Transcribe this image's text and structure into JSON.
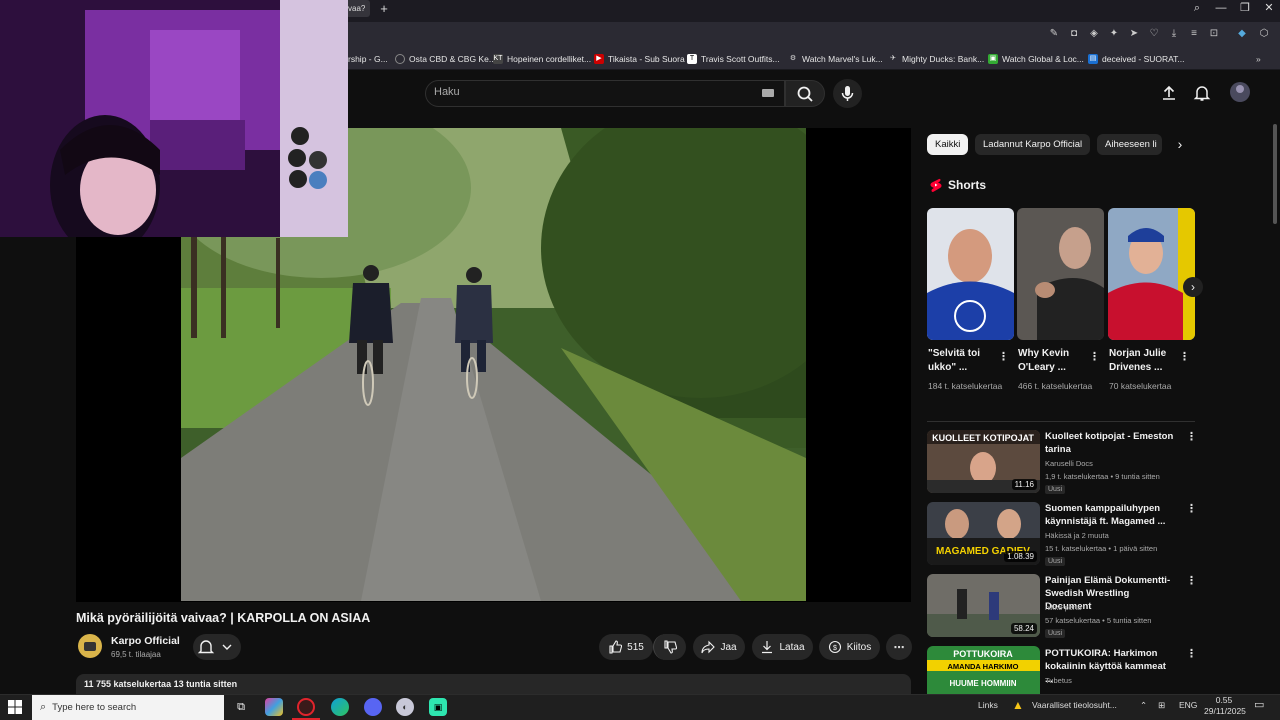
{
  "browser": {
    "active_tab_title": "vaa?",
    "bookmarks": [
      {
        "label": "rship - G...",
        "icon": "globe-icon"
      },
      {
        "label": "Osta CBD & CBG Ke...",
        "icon": "globe-icon"
      },
      {
        "label": "Hopeinen cordelliket...",
        "icon": "kt-icon"
      },
      {
        "label": "Tikaista - Sub Suora",
        "icon": "play-icon"
      },
      {
        "label": "Travis Scott Outfits...",
        "icon": "t-icon"
      },
      {
        "label": "Watch Marvel's Luk...",
        "icon": "gear-icon"
      },
      {
        "label": "Mighty Ducks: Bank...",
        "icon": "duck-icon"
      },
      {
        "label": "Watch Global & Loc...",
        "icon": "tv-icon"
      },
      {
        "label": "deceived - SUORAT...",
        "icon": "folder-icon"
      }
    ]
  },
  "header": {
    "search_placeholder": "Haku"
  },
  "video": {
    "title": "Mikä pyöräilijöitä vaivaa? | KARPOLLA ON ASIAA",
    "channel_name": "Karpo Official",
    "subscribers": "69,5 t. tilaajaa",
    "likes": "515",
    "share_label": "Jaa",
    "download_label": "Lataa",
    "thanks_label": "Kiitos",
    "description_meta": "11 755 katselukertaa  13 tuntia sitten"
  },
  "chips": [
    "Kaikki",
    "Ladannut Karpo Official",
    "Aiheeseen li"
  ],
  "shorts": {
    "heading": "Shorts",
    "items": [
      {
        "title": "\"Selvitä toi ukko\" ...",
        "views": "184 t. katselukertaa"
      },
      {
        "title": "Why Kevin O'Leary ...",
        "views": "466 t. katselukertaa"
      },
      {
        "title": "Norjan Julie Drivenes ...",
        "views": "70 katselukertaa"
      }
    ]
  },
  "recommendations": [
    {
      "title": "Kuolleet kotipojat - Emeston tarina",
      "channel": "Karuselli Docs",
      "meta": "1,9 t. katselukertaa • 9 tuntia sitten",
      "badge": "Uusi",
      "duration": "11.16"
    },
    {
      "title": "Suomen kamppailuhypen käynnistäjä ft. Magamed ...",
      "channel": "Häkissä ja 2 muuta",
      "meta": "15 t. katselukertaa • 1 päivä sitten",
      "badge": "Uusi",
      "duration": "1.08.39"
    },
    {
      "title": "Painijan Elämä Dokumentti- Swedish Wrestling Document",
      "channel": "nikke pena",
      "meta": "57 katselukertaa • 5 tuntia sitten",
      "badge": "Uusi",
      "duration": "58.24"
    },
    {
      "title": "POTTUKOIRA: Harkimon kokaiinin käyttöä kammeat ...",
      "channel": "Tubetus",
      "meta": "",
      "badge": "",
      "duration": ""
    }
  ],
  "thumb_text": {
    "rec1": "KUOLLEET KOTIPOJAT",
    "rec2": "MAGAMED GADIEV",
    "rec4a": "POTTUKOIRA",
    "rec4b": "AMANDA HARKIMO",
    "rec4c": "HUUME HOMMIIN"
  },
  "taskbar": {
    "search_placeholder": "Type here to search",
    "links_label": "Links",
    "weather_text": "Vaaralliset tieolosuht...",
    "language": "ENG",
    "time": "0.55",
    "date": "29/11/2025"
  },
  "colors": {
    "background": "#0f0f0f",
    "surface": "#272727",
    "shorts_red": "#ff0033",
    "text": "#f1f1f1",
    "muted": "#aaaaaa"
  }
}
